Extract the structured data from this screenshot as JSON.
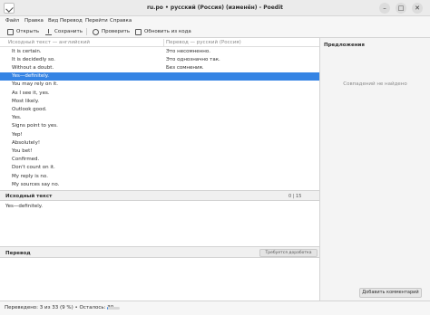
{
  "window": {
    "title": "ru.po • русский (Россия) (изменён) - Poedit",
    "minimize_glyph": "–",
    "maximize_glyph": "□",
    "close_glyph": "✕"
  },
  "menu": [
    "Файл",
    "Правка",
    "Вид",
    "Перевод",
    "Перейти",
    "Справка"
  ],
  "toolbar": {
    "open": "Открыть",
    "save": "Сохранить",
    "validate": "Проверить",
    "update": "Обновить из кода"
  },
  "list": {
    "source_header": "Исходный текст — английский",
    "translation_header": "Перевод — русский (Россия)",
    "rows": [
      {
        "source": "It is certain.",
        "translation": "Это несомненно."
      },
      {
        "source": "It is decidedly so.",
        "translation": "Это однозначно так."
      },
      {
        "source": "Without a doubt.",
        "translation": "Без сомнения."
      },
      {
        "source": "Yes—definitely.",
        "translation": ""
      },
      {
        "source": "You may rely on it.",
        "translation": ""
      },
      {
        "source": "As I see it, yes.",
        "translation": ""
      },
      {
        "source": "Most likely.",
        "translation": ""
      },
      {
        "source": "Outlook good.",
        "translation": ""
      },
      {
        "source": "Yes.",
        "translation": ""
      },
      {
        "source": "Signs point to yes.",
        "translation": ""
      },
      {
        "source": "Yep!",
        "translation": ""
      },
      {
        "source": "Absolutely!",
        "translation": ""
      },
      {
        "source": "You bet!",
        "translation": ""
      },
      {
        "source": "Confirmed.",
        "translation": ""
      },
      {
        "source": "Don't count on it.",
        "translation": ""
      },
      {
        "source": "My reply is no.",
        "translation": ""
      },
      {
        "source": "My sources say no.",
        "translation": ""
      }
    ],
    "selected_index": 3
  },
  "source_panel": {
    "title": "Исходный текст",
    "count": "0 | 15",
    "text": "Yes—definitely."
  },
  "translation_panel": {
    "title": "Перевод",
    "needs_work": "Требуется доработка"
  },
  "sidebar": {
    "title": "Предложения",
    "no_match": "Совпадений не найдено",
    "add_comment": "Добавить комментарий"
  },
  "status": {
    "text": "Переведено: 3 из 33 (9 %) • Осталось: 30",
    "progress_fraction": 0.09
  },
  "colors": {
    "selection": "#3584e4"
  }
}
